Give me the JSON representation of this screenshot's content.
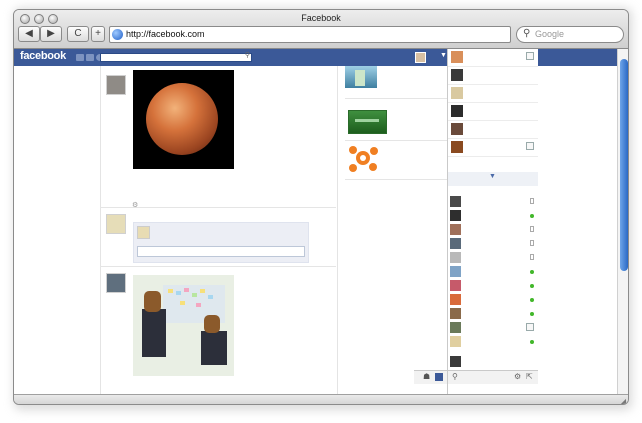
{
  "window": {
    "title": "Facebook"
  },
  "toolbar": {
    "back_label": "◀",
    "forward_label": "▶",
    "reload_label": "C",
    "add_label": "+",
    "url": "http://facebook.com",
    "search_placeholder": "Google"
  },
  "facebook": {
    "logo": "facebook"
  },
  "colors": {
    "facebook_blue": "#3b5998",
    "scroll_blue": "#2a69c6",
    "online_green": "#42b72a"
  }
}
